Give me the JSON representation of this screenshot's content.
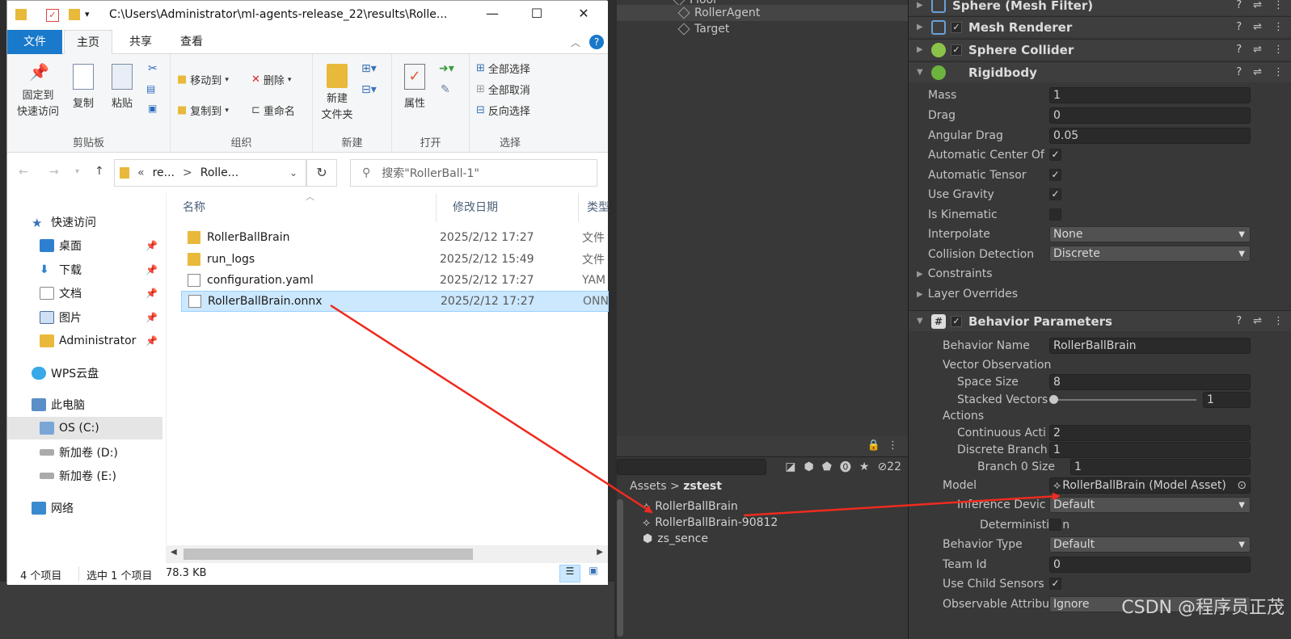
{
  "hierarchy": {
    "items": [
      "Floor",
      "RollerAgent",
      "Target"
    ]
  },
  "project": {
    "hidden_count": "22",
    "breadcrumb_root": "Assets",
    "breadcrumb_sep": ">",
    "breadcrumb_current": "zstest",
    "items": [
      "RollerBallBrain",
      "RollerBallBrain-90812",
      "zs_sence"
    ]
  },
  "inspector": {
    "components": {
      "mesh_filter": "Sphere (Mesh Filter)",
      "mesh_renderer": "Mesh Renderer",
      "sphere_collider": "Sphere Collider",
      "rigidbody": "Rigidbody",
      "behavior_parameters": "Behavior Parameters"
    },
    "rigidbody": {
      "mass_label": "Mass",
      "mass": "1",
      "drag_label": "Drag",
      "drag": "0",
      "angular_drag_label": "Angular Drag",
      "angular_drag": "0.05",
      "auto_center_label": "Automatic Center Of",
      "auto_tensor_label": "Automatic Tensor",
      "use_gravity_label": "Use Gravity",
      "is_kinematic_label": "Is Kinematic",
      "interpolate_label": "Interpolate",
      "interpolate": "None",
      "collision_label": "Collision Detection",
      "collision": "Discrete",
      "constraints_label": "Constraints",
      "layer_overrides_label": "Layer Overrides"
    },
    "behavior": {
      "name_label": "Behavior Name",
      "name": "RollerBallBrain",
      "vector_obs_label": "Vector Observation",
      "space_size_label": "Space Size",
      "space_size": "8",
      "stacked_label": "Stacked Vectors",
      "stacked": "1",
      "actions_label": "Actions",
      "continuous_label": "Continuous Acti",
      "continuous": "2",
      "discrete_label": "Discrete Branch",
      "discrete": "1",
      "branch0_label": "Branch 0 Size",
      "branch0": "1",
      "model_label": "Model",
      "model": "RollerBallBrain (Model Asset)",
      "inference_label": "Inference Devic",
      "inference": "Default",
      "deterministic_label": "Deterministic In",
      "behavior_type_label": "Behavior Type",
      "behavior_type": "Default",
      "team_id_label": "Team Id",
      "team_id": "0",
      "child_sensors_label": "Use Child Sensors",
      "observable_label": "Observable Attribu",
      "observable": "Ignore"
    }
  },
  "explorer": {
    "title": "C:\\Users\\Administrator\\ml-agents-release_22\\results\\Rolle...",
    "tabs": {
      "file": "文件",
      "home": "主页",
      "share": "共享",
      "view": "查看"
    },
    "ribbon": {
      "pin": "固定到\n快速访问",
      "copy": "复制",
      "paste": "粘贴",
      "clipboard": "剪贴板",
      "move_to": "移动到",
      "copy_to": "复制到",
      "delete": "删除",
      "rename": "重命名",
      "organize": "组织",
      "new_folder": "新建\n文件夹",
      "new": "新建",
      "properties": "属性",
      "open": "打开",
      "select_all": "全部选择",
      "select_none": "全部取消",
      "invert": "反向选择",
      "select": "选择"
    },
    "address": {
      "prefix": "«",
      "part1": "re...",
      "sep": ">",
      "part2": "Rolle..."
    },
    "search_placeholder": "搜索\"RollerBall-1\"",
    "nav": [
      "快速访问",
      "桌面",
      "下载",
      "文档",
      "图片",
      "Administrator",
      "WPS云盘",
      "此电脑",
      "OS (C:)",
      "新加卷 (D:)",
      "新加卷 (E:)",
      "网络"
    ],
    "columns": {
      "name": "名称",
      "modified": "修改日期",
      "type": "类型"
    },
    "files": [
      {
        "name": "RollerBallBrain",
        "date": "2025/2/12 17:27",
        "type": "文件"
      },
      {
        "name": "run_logs",
        "date": "2025/2/12 15:49",
        "type": "文件"
      },
      {
        "name": "configuration.yaml",
        "date": "2025/2/12 17:27",
        "type": "YAM"
      },
      {
        "name": "RollerBallBrain.onnx",
        "date": "2025/2/12 17:27",
        "type": "ONN"
      }
    ],
    "status": {
      "count": "4 个项目",
      "selected": "选中 1 个项目",
      "size": "78.3 KB"
    }
  },
  "watermark": "CSDN @程序员正茂",
  "colors": {
    "accent": "#1979ca",
    "arrow": "#ee2b1f",
    "unity_bg": "#383838"
  }
}
